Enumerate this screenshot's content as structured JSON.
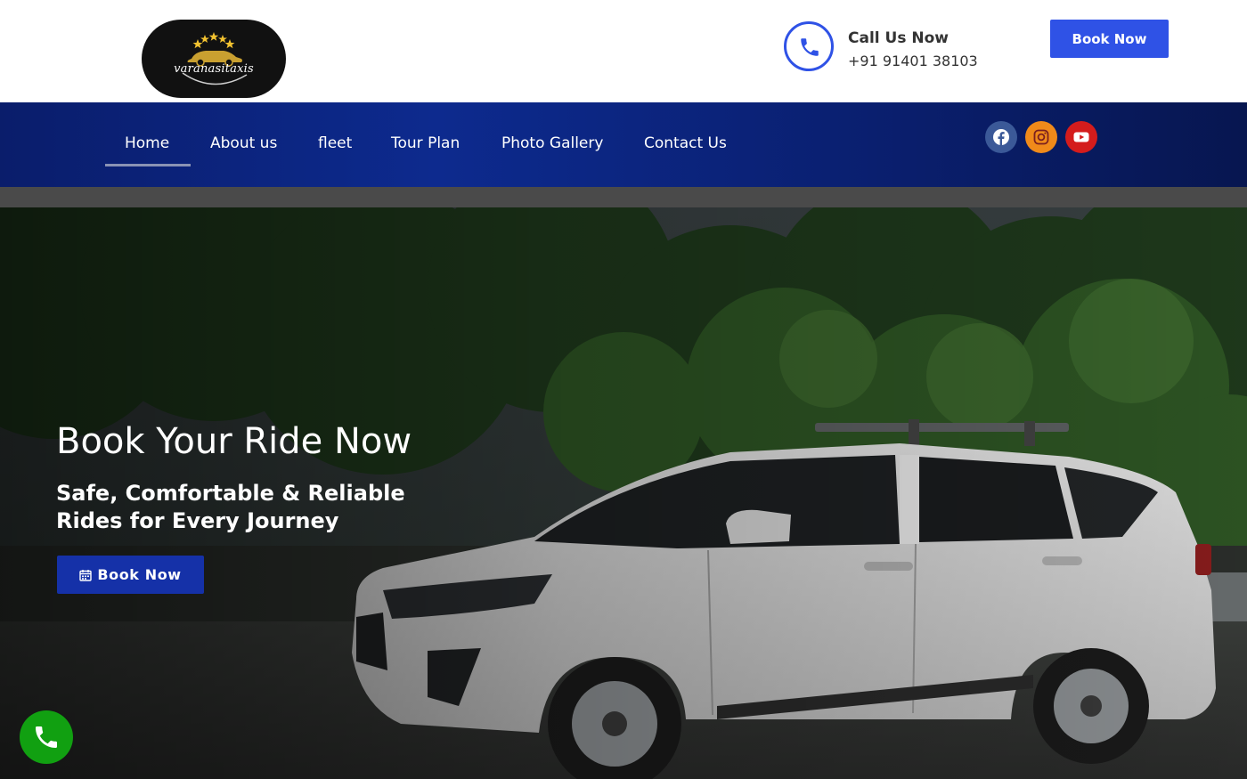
{
  "header": {
    "logo_text": "varanasitaxis",
    "call_title": "Call Us Now",
    "call_number": "+91 91401 38103",
    "book_button": "Book Now"
  },
  "nav": {
    "items": [
      {
        "label": "Home",
        "active": true
      },
      {
        "label": "About us"
      },
      {
        "label": "fleet"
      },
      {
        "label": "Tour Plan"
      },
      {
        "label": "Photo Gallery"
      },
      {
        "label": "Contact Us"
      }
    ],
    "social": [
      {
        "icon": "facebook-icon",
        "color": "#3b5998"
      },
      {
        "icon": "instagram-icon",
        "color": "#f08a1a"
      },
      {
        "icon": "youtube-icon",
        "color": "#d41c1c"
      }
    ]
  },
  "hero": {
    "title": "Book Your Ride Now",
    "subtitle": "Safe, Comfortable & Reliable Rides for Every Journey",
    "button": "Book Now",
    "button_icon": "calendar-icon"
  },
  "colors": {
    "accent": "#2f52e6",
    "nav_bg": "#0d2a8e",
    "hero_button": "#1531a8",
    "float_call": "#11a011"
  },
  "float_call_icon": "phone-icon"
}
